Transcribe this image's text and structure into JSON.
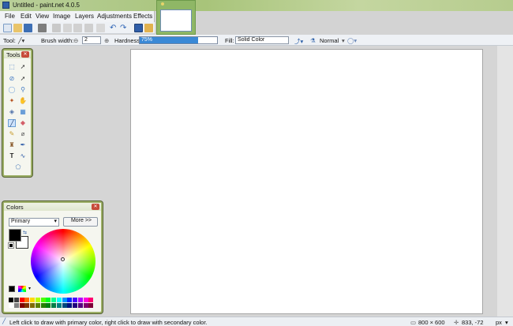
{
  "window": {
    "title": "Untitled - paint.net 4.0.5"
  },
  "menu": [
    "File",
    "Edit",
    "View",
    "Image",
    "Layers",
    "Adjustments",
    "Effects"
  ],
  "toolbar": {
    "tool_label": "Tool:",
    "brush_width_label": "Brush width:",
    "brush_width_value": "2",
    "hardness_label": "Hardness:",
    "hardness_value": "75%",
    "hardness_fraction": 0.75,
    "fill_label": "Fill:",
    "fill_value": "Solid Color",
    "blend_mode": "Normal"
  },
  "tools_panel": {
    "title": "Tools"
  },
  "colors_panel": {
    "title": "Colors",
    "mode_select": "Primary",
    "more_button": "More >>",
    "primary_color": "#000000",
    "secondary_color": "#ffffff"
  },
  "status": {
    "hint": "Left click to draw with primary color, right click to draw with secondary color.",
    "image_size": "800 × 600",
    "cursor_pos": "833, -72",
    "units": "px"
  },
  "colors": {
    "accent": "#3a89d6",
    "panel_border": "#9cae66"
  }
}
